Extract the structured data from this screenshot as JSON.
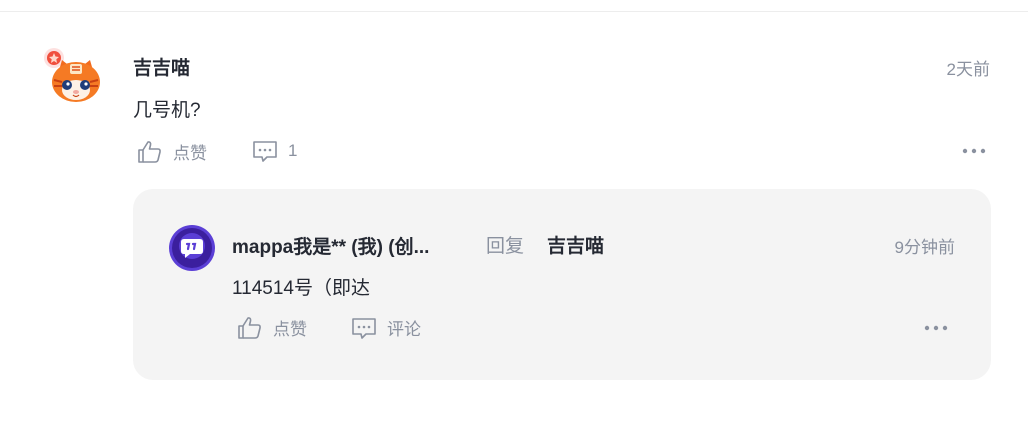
{
  "comment": {
    "author": "吉吉喵",
    "time": "2天前",
    "content": "几号机?",
    "like_label": "点赞",
    "reply_count": "1"
  },
  "reply": {
    "author": "mappa我是** (我) (创...",
    "reply_word": "回复",
    "reply_to": "吉吉喵",
    "time": "9分钟前",
    "content": "114514号（即达",
    "like_label": "点赞",
    "comment_label": "评论"
  },
  "colors": {
    "text_primary": "#252933",
    "text_secondary": "#8a919f",
    "reply_bg": "#f4f4f4",
    "reply_avatar": "#5b3fd6"
  }
}
